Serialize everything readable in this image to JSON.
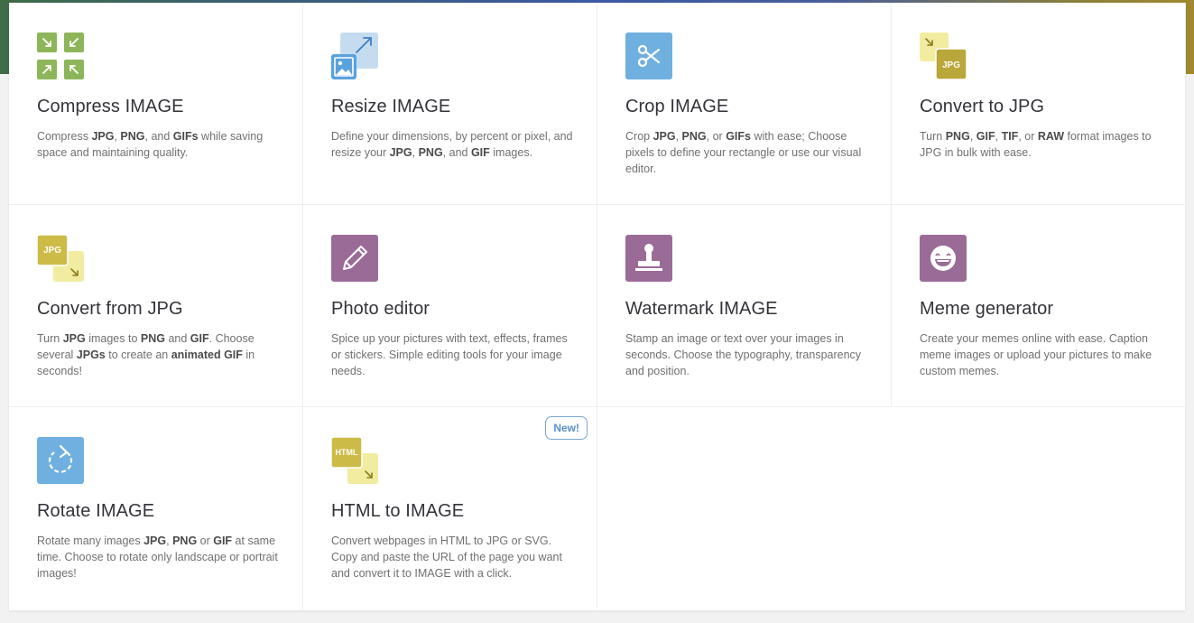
{
  "tools": [
    {
      "id": "compress",
      "title": "Compress IMAGE",
      "desc": [
        {
          "t": "Compress "
        },
        {
          "t": "JPG",
          "b": true
        },
        {
          "t": ", "
        },
        {
          "t": "PNG",
          "b": true
        },
        {
          "t": ", and "
        },
        {
          "t": "GIFs",
          "b": true
        },
        {
          "t": " while saving space and maintaining quality."
        }
      ],
      "icon": "compress-arrows-icon",
      "color": "#8db65a"
    },
    {
      "id": "resize",
      "title": "Resize IMAGE",
      "desc": [
        {
          "t": "Define your dimensions, by percent or pixel, and resize your "
        },
        {
          "t": "JPG",
          "b": true
        },
        {
          "t": ", "
        },
        {
          "t": "PNG",
          "b": true
        },
        {
          "t": ", and "
        },
        {
          "t": "GIF",
          "b": true
        },
        {
          "t": " images."
        }
      ],
      "icon": "resize-image-icon",
      "color": "#5aa2dc"
    },
    {
      "id": "crop",
      "title": "Crop IMAGE",
      "desc": [
        {
          "t": "Crop "
        },
        {
          "t": "JPG",
          "b": true
        },
        {
          "t": ", "
        },
        {
          "t": "PNG",
          "b": true
        },
        {
          "t": ", or "
        },
        {
          "t": "GIFs",
          "b": true
        },
        {
          "t": " with ease; Choose pixels to define your rectangle or use our visual editor."
        }
      ],
      "icon": "scissors-icon",
      "color": "#6fb0e0"
    },
    {
      "id": "convert-to-jpg",
      "title": "Convert to JPG",
      "desc": [
        {
          "t": "Turn "
        },
        {
          "t": "PNG",
          "b": true
        },
        {
          "t": ", "
        },
        {
          "t": "GIF",
          "b": true
        },
        {
          "t": ", "
        },
        {
          "t": "TIF",
          "b": true
        },
        {
          "t": ", or "
        },
        {
          "t": "RAW",
          "b": true
        },
        {
          "t": " format images to JPG in bulk with ease."
        }
      ],
      "icon": "convert-to-jpg-icon",
      "icon_label": "JPG",
      "color": "#b9a739"
    },
    {
      "id": "convert-from-jpg",
      "title": "Convert from JPG",
      "desc": [
        {
          "t": "Turn "
        },
        {
          "t": "JPG",
          "b": true
        },
        {
          "t": " images to "
        },
        {
          "t": "PNG",
          "b": true
        },
        {
          "t": " and "
        },
        {
          "t": "GIF",
          "b": true
        },
        {
          "t": ". Choose several "
        },
        {
          "t": "JPGs",
          "b": true
        },
        {
          "t": " to create an "
        },
        {
          "t": "animated GIF",
          "b": true
        },
        {
          "t": " in seconds!"
        }
      ],
      "icon": "convert-from-jpg-icon",
      "icon_label": "JPG",
      "color": "#cdbb47"
    },
    {
      "id": "photo-editor",
      "title": "Photo editor",
      "desc": [
        {
          "t": "Spice up your pictures with text, effects, frames or stickers. Simple editing tools for your image needs."
        }
      ],
      "icon": "pencil-icon",
      "color": "#9b6b98"
    },
    {
      "id": "watermark",
      "title": "Watermark IMAGE",
      "desc": [
        {
          "t": "Stamp an image or text over your images in seconds. Choose the typography, transparency and position."
        }
      ],
      "icon": "stamp-icon",
      "color": "#9b6b98"
    },
    {
      "id": "meme",
      "title": "Meme generator",
      "desc": [
        {
          "t": "Create your memes online with ease. Caption meme images or upload your pictures to make custom memes."
        }
      ],
      "icon": "laughing-face-icon",
      "color": "#9b6b98"
    },
    {
      "id": "rotate",
      "title": "Rotate IMAGE",
      "desc": [
        {
          "t": "Rotate many images "
        },
        {
          "t": "JPG",
          "b": true
        },
        {
          "t": ", "
        },
        {
          "t": "PNG",
          "b": true
        },
        {
          "t": " or "
        },
        {
          "t": "GIF",
          "b": true
        },
        {
          "t": " at same time. Choose to rotate only landscape or portrait images!"
        }
      ],
      "icon": "rotate-icon",
      "color": "#6fb0e0"
    },
    {
      "id": "html-to-image",
      "title": "HTML to IMAGE",
      "desc": [
        {
          "t": "Convert webpages in HTML to JPG or SVG. Copy and paste the URL of the page you want and convert it to IMAGE with a click."
        }
      ],
      "icon": "html-to-image-icon",
      "icon_label": "HTML",
      "color": "#cdbb47",
      "badge": "New!"
    }
  ]
}
